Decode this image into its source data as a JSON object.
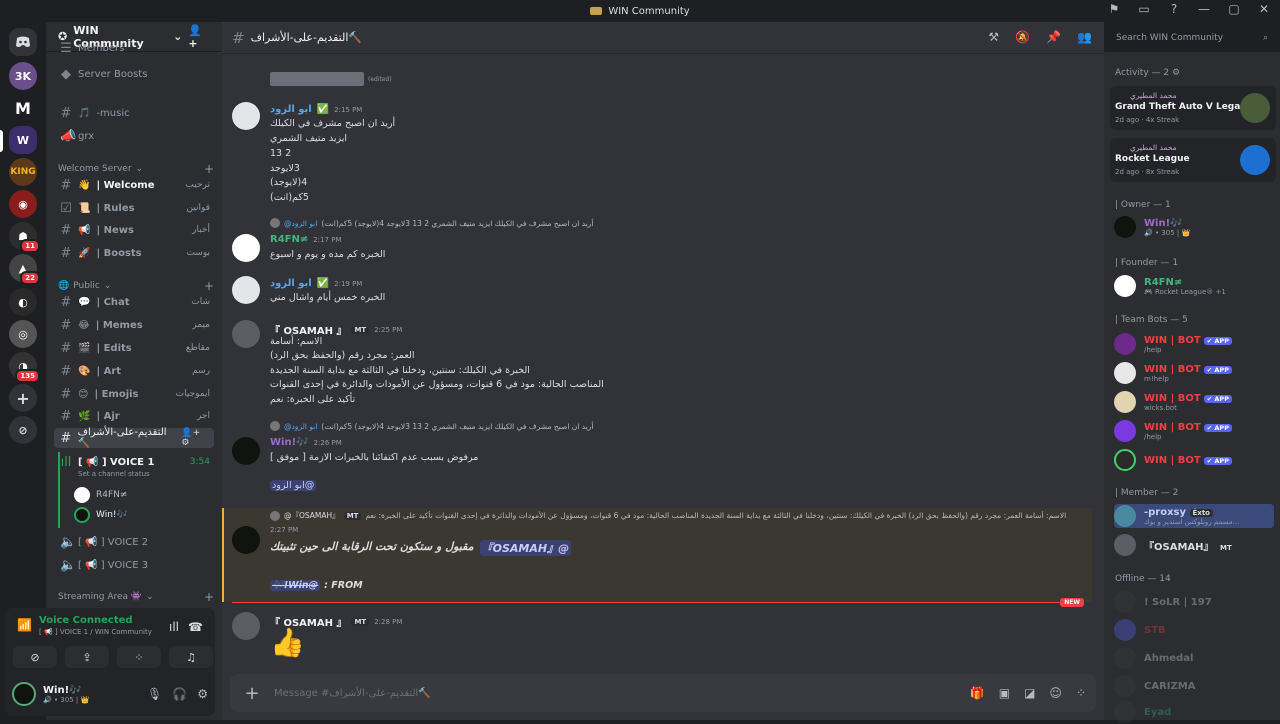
{
  "window": {
    "title": "WIN Community"
  },
  "server": {
    "name": "WIN Community",
    "dropdown_icon": "chevron-down-icon"
  },
  "guild_badges": [
    "11",
    "22",
    "135"
  ],
  "channels": {
    "members_label": "Members",
    "server_boosts": "Server Boosts",
    "music": "-music",
    "grx": "grx",
    "cat_welcome": "Welcome Server",
    "welcome": {
      "emoji": "👋",
      "label": "| Welcome",
      "ar": "ترحيب"
    },
    "rules": {
      "emoji": "📜",
      "label": "| Rules",
      "ar": "قوانين"
    },
    "news": {
      "emoji": "📢",
      "label": "| News",
      "ar": "أخبار"
    },
    "boosts": {
      "emoji": "🚀",
      "label": "| Boosts",
      "ar": "بوست"
    },
    "cat_public": "Public",
    "chat": {
      "emoji": "💬",
      "label": "| Chat",
      "ar": "شات"
    },
    "memes": {
      "emoji": "😂",
      "label": "| Memes",
      "ar": "ميمز"
    },
    "edits": {
      "emoji": "🎬",
      "label": "| Edits",
      "ar": "مقاطع"
    },
    "art": {
      "emoji": "🎨",
      "label": "| Art",
      "ar": "رسم"
    },
    "emojis": {
      "emoji": "😊",
      "label": "| Emojis",
      "ar": "ايموجيات"
    },
    "ajr": {
      "emoji": "🌿",
      "label": "| Ajr",
      "ar": "اجر"
    },
    "active": "التقديم-على-الأشراف🔨",
    "voice1": "[ 📢 ] VOICE 1",
    "voice1_time": "3:54",
    "voice1_status": "Set a channel status",
    "voice_users": [
      "R4FN≠",
      "Win!🎶"
    ],
    "voice2": "[ 📢 ] VOICE 2",
    "voice3": "[ 📢 ] VOICE 3",
    "cat_streaming": "Streaming Area 👾"
  },
  "voice_panel": {
    "connected": "Voice Connected",
    "sub": "[ 📢 ] VOICE 1 / WIN Community"
  },
  "user_panel": {
    "name": "Win!🎶",
    "sub": "🔊 • 305 | 👑"
  },
  "channel_header": {
    "name": "التقديم-على-الأشراف🔨"
  },
  "search": {
    "placeholder": "Search WIN Community"
  },
  "messages": {
    "edited": "(edited)",
    "m1": {
      "name": "ابو الزود",
      "time": "2:15 PM",
      "lines": [
        "أريد ان اصبح مشرف في الكيلك",
        "ايزيد متيف الشمري",
        "13 2",
        "3لايوجد",
        "4(لايوجد)",
        "5كم(انت)"
      ]
    },
    "m2": {
      "reply": "أريد ان اصبح مشرف في الكيلك ايزيد متيف الشمري 2 13 3لايوجد 4(لايوجد) 5كم(انت)",
      "reply_name": "@ابو الزود",
      "name": "R4FN≠",
      "time": "2:17 PM",
      "line": "الخبره كم مده و يوم و اسبوع"
    },
    "m3": {
      "name": "ابو الزود",
      "time": "2:19 PM",
      "line": "الخبره خمس أيام واشال مني"
    },
    "m4": {
      "name": "『 OSAMAH 』",
      "tag": "MT",
      "time": "2:25 PM",
      "lines": [
        "الاسم: أسامة",
        "العمر: مجرد رقم (والحفظ بحق الرد)",
        "الخبرة في الكيلك: سنتين، ودخلنا في الثالثة مع بداية السنة الجديدة",
        "المناصب الحالية: مود في 6 قنوات، ومسؤول عن الأمودات والدائرة في إحدى القنوات",
        "تأكيد على الخبرة: نعم"
      ]
    },
    "m5": {
      "reply": "أريد ان اصبح مشرف في الكيلك ايزيد متيف الشمري 2 13 3لايوجد 4(لايوجد) 5كم(انت)",
      "reply_name": "@ابو الزود",
      "name": "Win!🎶",
      "time": "2:26 PM",
      "line": "مرفوض بسبب عدم اكتفائنا بالخبرات الازمة [ موفق ]",
      "mention": "@ابو الزود"
    },
    "m6": {
      "reply": "الاسم: أسامة العمر: مجرد رقم (والحفظ بحق الرد) الخبرة في الكيلك: سنتين، ودخلنا في الثالثة مع بداية السنة الجديدة المناصب الحالية: مود في 6 قنوات، ومسؤول عن الأمودات والدائرة في إحدى القنوات تأكيد على الخبرة: نعم",
      "reply_name": "@『OSAMAH』",
      "reply_tag": "MT",
      "time": "2:27 PM",
      "mention": "@『OSAMAH』",
      "line": "مقبول و ستكون تحت الرقابة الى حين تثبيتك",
      "from": "FROM :",
      "from_user": "@Win!🎶"
    },
    "new_label": "NEW",
    "m7": {
      "name": "『 OSAMAH 』",
      "tag": "MT",
      "time": "2:28 PM",
      "emoji": "👍"
    }
  },
  "composer": {
    "placeholder": "Message #التقديم-على-الأشراف🔨"
  },
  "members": {
    "activity_header": "Activity — 2",
    "activities": [
      {
        "who": "محمد المطيري",
        "game": "Grand Theft Auto V Legacy",
        "ago": "2d ago",
        "streak": "4x Streak"
      },
      {
        "who": "محمد المطيري",
        "game": "Rocket League",
        "ago": "2d ago",
        "streak": "8x Streak"
      }
    ],
    "owner_header": "| Owner — 1",
    "owner": {
      "name": "Win!🎶",
      "status": "🔊 • 305 | 👑"
    },
    "founder_header": "| Founder — 1",
    "founder": {
      "name": "R4FN≠",
      "status": "🎮 Rocket League® +1"
    },
    "bots_header": "| Team Bots — 5",
    "bots": [
      {
        "name": "WIN | BOT",
        "status": "/help",
        "badge": "✔ APP"
      },
      {
        "name": "WIN | BOT",
        "status": "m!help",
        "badge": "✔ APP"
      },
      {
        "name": "WIN | BOT",
        "status": "wicks.bot",
        "badge": "✔ APP"
      },
      {
        "name": "WIN | BOT",
        "status": "/help",
        "badge": "✔ APP"
      },
      {
        "name": "WIN | BOT",
        "status": "",
        "badge": "✔ APP"
      }
    ],
    "member_header": "| Member — 2",
    "member1": {
      "name": "-proxsy",
      "tag": "Ěxto",
      "status": "مسمم روبلوكس استدير و بوك..."
    },
    "member2": {
      "name": "『OSAMAH』",
      "tag": "MT"
    },
    "offline_header": "Offline — 14",
    "offline": [
      "! SoLR | 197",
      "STB",
      "Ahmedal",
      "CARIZMA",
      "Eyad"
    ]
  }
}
